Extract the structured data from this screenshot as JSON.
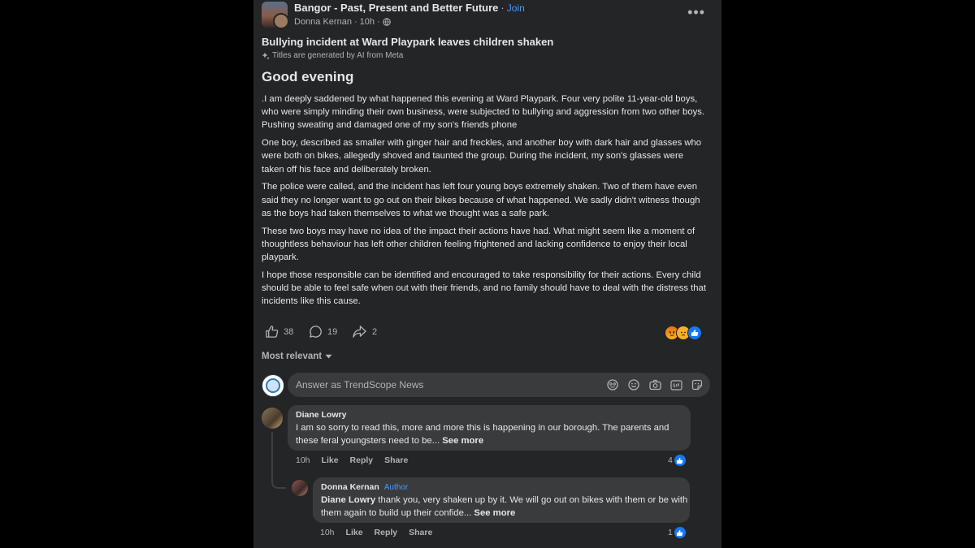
{
  "post": {
    "group_name": "Bangor - Past, Present and Better Future",
    "join_label": "Join",
    "author": "Donna Kernan",
    "time": "10h",
    "title": "Bullying incident at Ward Playpark leaves children shaken",
    "ai_note": "Titles are generated by AI from Meta",
    "greeting": "Good evening",
    "paragraphs": [
      ".I am deeply saddened by what happened this evening at Ward Playpark. Four very polite 11-year-old boys, who were simply minding their own business, were subjected to bullying and aggression from two other boys. Pushing sweating and damaged one of my son's friends phone",
      "One boy, described as smaller with ginger hair and freckles, and another boy with dark hair and glasses who were both on bikes, allegedly shoved and taunted the group. During the incident, my son's glasses were taken off his face and deliberately broken.",
      "The police were called, and the incident has left four young boys extremely shaken. Two of them have even said they no longer want to go out on their bikes because of what happened. We sadly didn't witness though as the boys had taken themselves to what we thought was a safe park.",
      "These two boys may have no idea of the impact their actions have had. What might seem like a moment of thoughtless behaviour has left other children feeling frightened and lacking confidence to enjoy their local playpark.",
      "I hope those responsible can be identified and encouraged to take responsibility for their actions. Every child should be able to feel safe when out with their friends, and no family should have to deal with the distress that incidents like this cause."
    ],
    "likes": "38",
    "comments": "19",
    "shares": "2",
    "reactions": [
      "angry-reaction",
      "sad-reaction",
      "like-reaction"
    ]
  },
  "comments_section": {
    "sort_label": "Most relevant",
    "composer_placeholder": "Answer as TrendScope News",
    "composer_tools": [
      "avatar-sticker-icon",
      "emoji-icon",
      "camera-icon",
      "gif-icon",
      "sticker-icon"
    ]
  },
  "comments": [
    {
      "name": "Diane Lowry",
      "text": "I am so sorry to read this, more and more this is happening in our borough. The parents and these feral youngsters need to be...",
      "see_more": "See more",
      "time": "10h",
      "like": "Like",
      "reply": "Reply",
      "share": "Share",
      "count": "4"
    },
    {
      "name": "Donna Kernan",
      "badge": "Author",
      "mention": "Diane Lowry",
      "text": " thank you, very shaken up by it. We will go out on bikes with them or be with them again to build up their confide...",
      "see_more": "See more",
      "time": "10h",
      "like": "Like",
      "reply": "Reply",
      "share": "Share",
      "count": "1"
    }
  ],
  "colors": {
    "background": "#000000",
    "panel": "#242526",
    "bubble": "#3a3b3c",
    "text": "#e4e6eb",
    "secondary": "#b0b3b8",
    "link": "#4599ff",
    "like_blue": "#1877f2"
  }
}
